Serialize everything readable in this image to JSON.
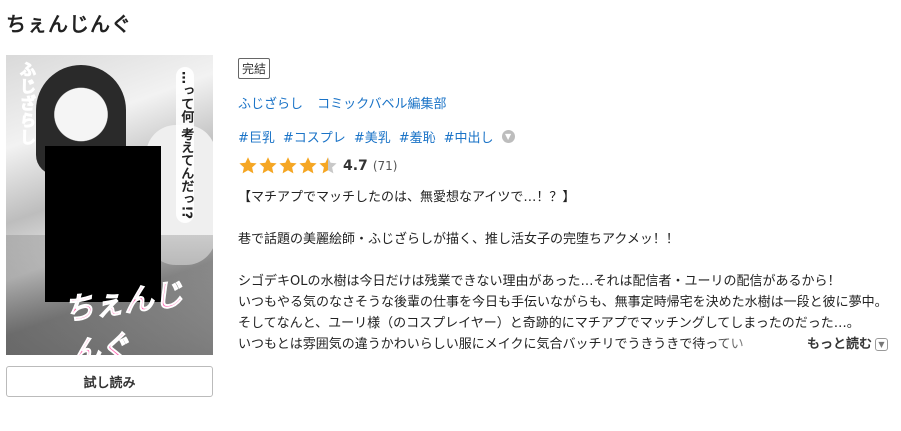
{
  "title": "ちぇんじんぐ",
  "cover": {
    "author_text": "ふじざらし",
    "bubble_text": "…って何 考えてんだっ!?",
    "logo_text": "ちぇんじんぐ"
  },
  "trial_button": "試し読み",
  "badge": "完結",
  "authors": [
    "ふじざらし",
    "コミックバベル編集部"
  ],
  "tags": [
    "#巨乳",
    "#コスプレ",
    "#美乳",
    "#羞恥",
    "#中出し"
  ],
  "rating": {
    "value": "4.7",
    "count": "(71)",
    "stars": 4.5,
    "star_color": "#f5a623"
  },
  "description": {
    "line1": "【マチアプでマッチしたのは、無愛想なアイツで…！？】",
    "line2": "巷で話題の美麗絵師・ふじざらしが描く、推し活女子の完堕ちアクメッ！！",
    "line3": "シゴデキOLの水樹は今日だけは残業できない理由があった…それは配信者・ユーリの配信があるから！",
    "line4": "いつもやる気のなさそうな後輩の仕事を今日も手伝いながらも、無事定時帰宅を決めた水樹は一段と彼に夢中。",
    "line5": "そしてなんと、ユーリ様（のコスプレイヤー）と奇跡的にマチアプでマッチングしてしまったのだった…。",
    "line6": "いつもとは雰囲気の違うかわいらしい服にメイクに気合バッチリでうきうきで待ってい"
  },
  "more_label": "もっと読む"
}
